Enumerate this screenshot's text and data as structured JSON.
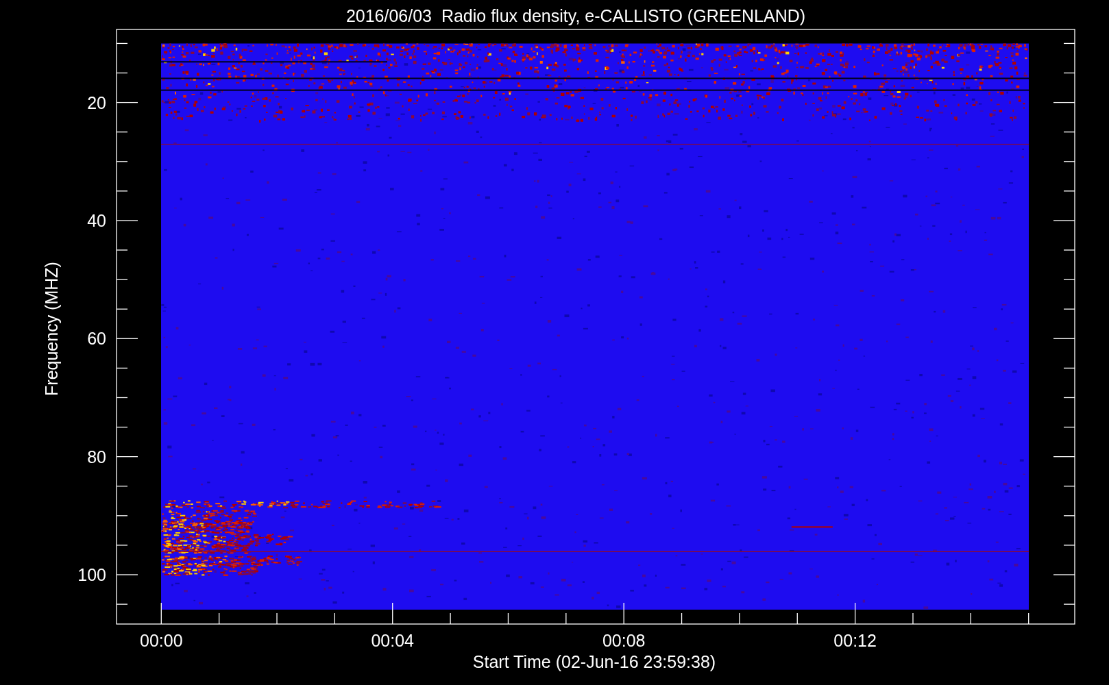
{
  "plot": {
    "title": "2016/06/03  Radio flux density, e-CALLISTO (GREENLAND)",
    "ylabel": "Frequency (MHZ)",
    "xlabel": "Start Time (02-Jun-16 23:59:38)",
    "y_ticks": [
      "20",
      "40",
      "60",
      "80",
      "100"
    ],
    "x_ticks": [
      "00:00",
      "00:04",
      "00:08",
      "00:12"
    ]
  }
}
